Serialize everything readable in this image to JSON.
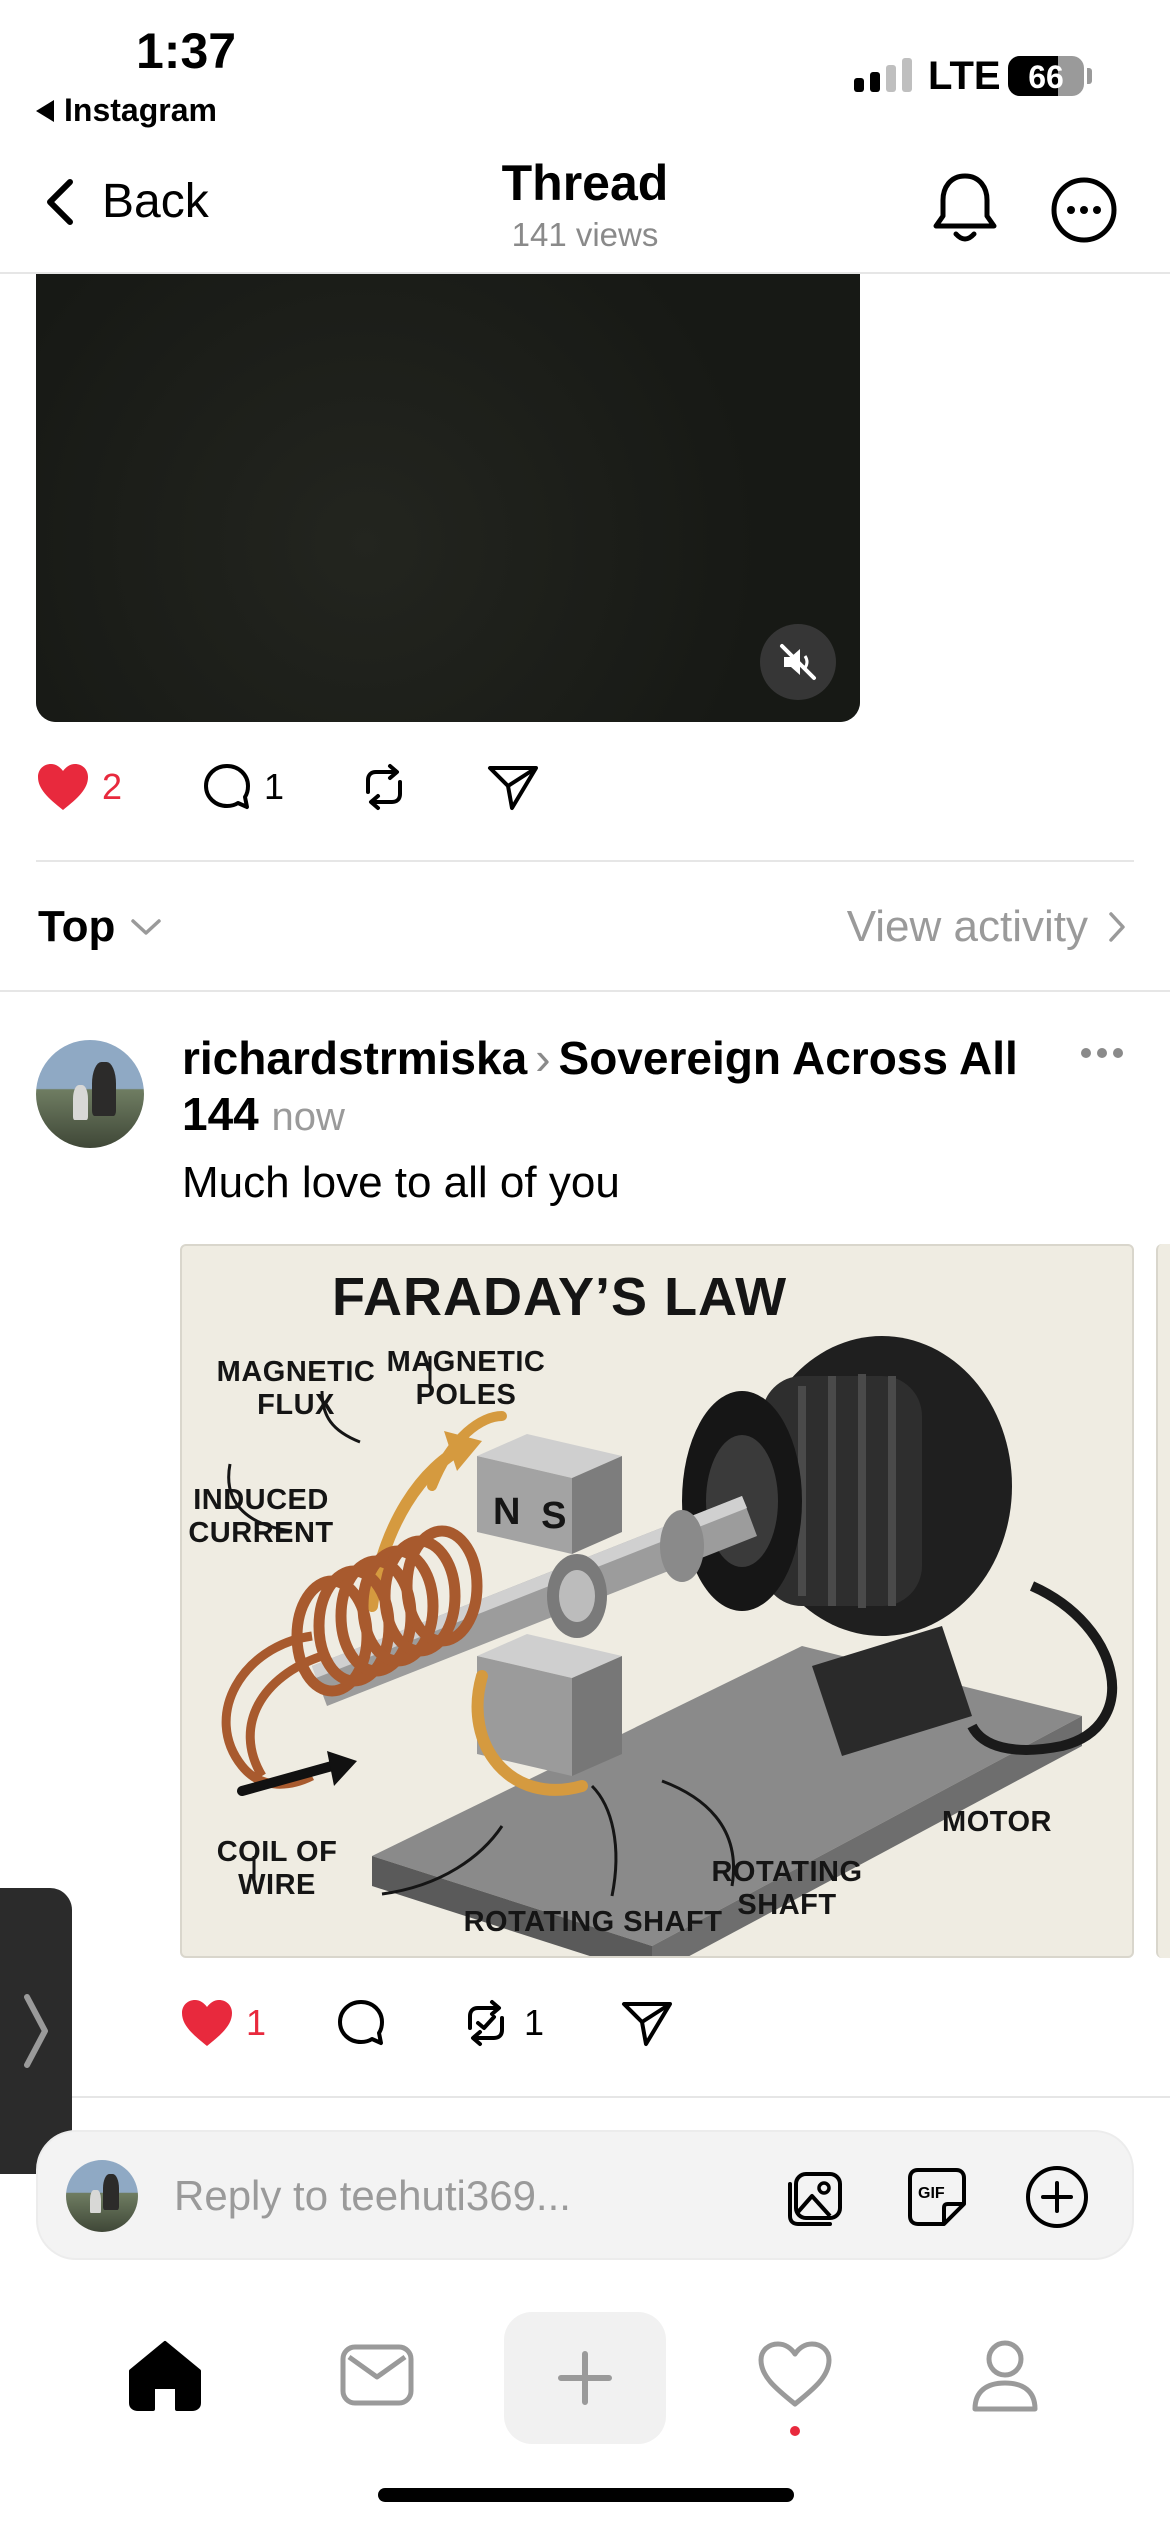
{
  "status_bar": {
    "time": "1:37",
    "back_app": "Instagram",
    "network": "LTE",
    "battery": "66"
  },
  "nav": {
    "back_label": "Back",
    "title": "Thread",
    "views": "141 views"
  },
  "video": {
    "muted": true
  },
  "main_post": {
    "likes": "2",
    "comments": "1",
    "liked": true
  },
  "sort": {
    "label": "Top",
    "view_activity": "View activity"
  },
  "reply": {
    "username": "richardstrmiska",
    "community": "Sovereign Across All 144",
    "time": "now",
    "text": "Much love to all of you",
    "likes": "1",
    "reposts": "1",
    "image": {
      "title": "FARADAY’S LAW",
      "labels": {
        "magnetic_flux": "MAGNETIC FLUX",
        "magnetic_poles": "MAGNETIC POLES",
        "induced_current": "INDUCED CURRENT",
        "coil_of_wire": "COIL OF WIRE",
        "rotating_shaft_1": "ROTATING SHAFT",
        "rotating_shaft_2": "ROTATING SHAFT",
        "motor": "MOTOR",
        "pole_n": "N",
        "pole_s": "S"
      }
    }
  },
  "reply_bar": {
    "placeholder": "Reply to teehuti369..."
  },
  "bottom_nav": {
    "items": [
      "home-icon",
      "inbox-icon",
      "plus-icon",
      "heart-icon",
      "profile-icon"
    ]
  },
  "colors": {
    "like_red": "#e8293d",
    "muted_gray": "#9a9a9a",
    "coil_copper": "#a85a2e",
    "arrow_orange": "#d59a3f"
  }
}
